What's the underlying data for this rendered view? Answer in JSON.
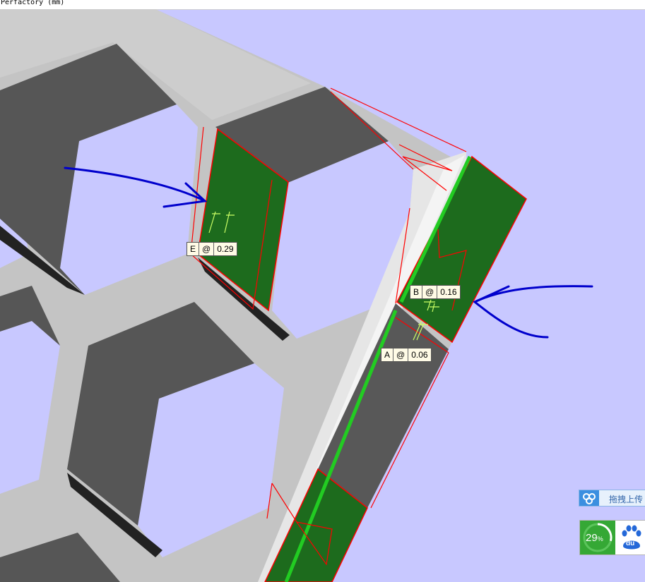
{
  "window": {
    "title": "Perfactory (mm)"
  },
  "labels": [
    {
      "id": "E",
      "at": "@",
      "value": "0.29"
    },
    {
      "id": "B",
      "at": "@",
      "value": "0.16"
    },
    {
      "id": "A",
      "at": "@",
      "value": "0.06"
    }
  ],
  "baidu": {
    "upload_label": "拖拽上传",
    "progress_percent": "29",
    "percent_sign": "%",
    "logo_text": "du"
  },
  "colors": {
    "background": "#c8c8ff",
    "mesh_light": "#c4c4c4",
    "mesh_dark": "#555555",
    "support_green": "#1e6b1e",
    "highlight_red": "#ff0000",
    "annotation_arrow": "#0000cc"
  }
}
